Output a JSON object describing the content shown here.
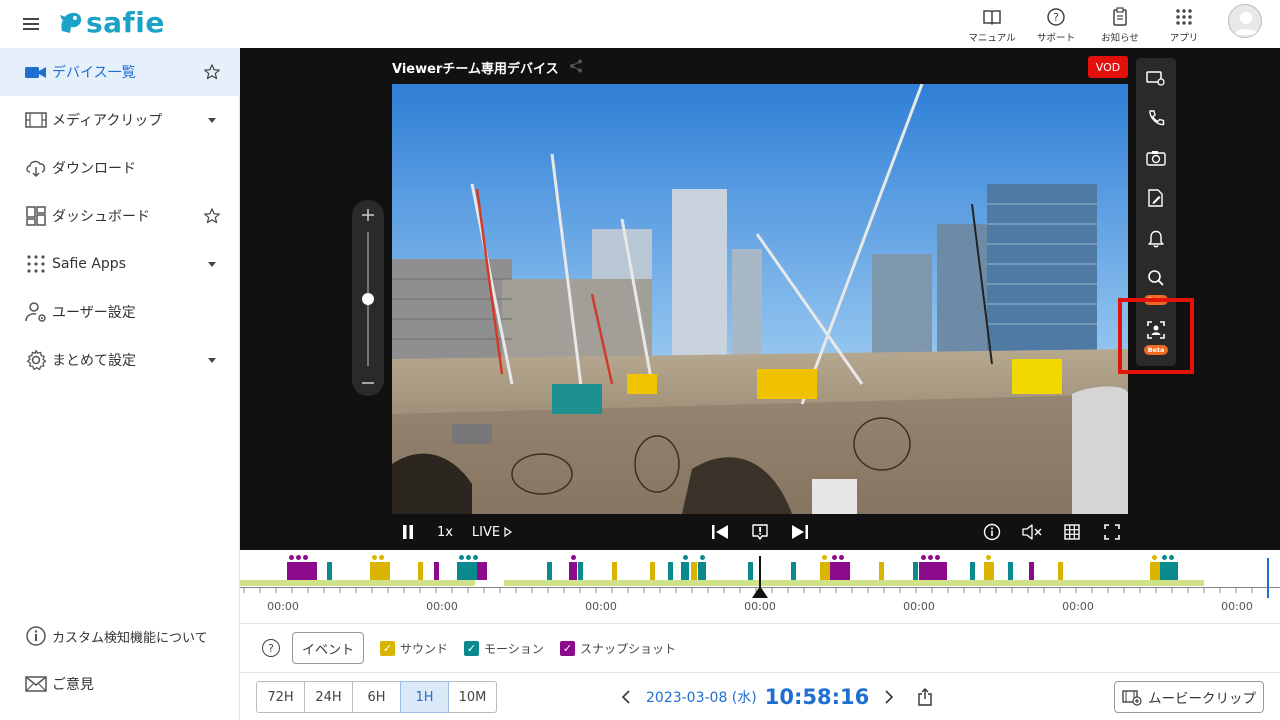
{
  "header": {
    "logo_text": "safie",
    "buttons": [
      {
        "label": "マニュアル",
        "icon": "book-icon"
      },
      {
        "label": "サポート",
        "icon": "help-circle-icon"
      },
      {
        "label": "お知らせ",
        "icon": "clipboard-icon"
      },
      {
        "label": "アプリ",
        "icon": "apps-grid-icon"
      }
    ]
  },
  "sidebar": {
    "items": [
      {
        "label": "デバイス一覧",
        "icon": "video-camera-icon",
        "active": true
      },
      {
        "label": "メディアクリップ",
        "icon": "film-icon"
      },
      {
        "label": "ダウンロード",
        "icon": "cloud-download-icon"
      },
      {
        "label": "ダッシュボード",
        "icon": "dashboard-icon"
      },
      {
        "label": "Safie Apps",
        "icon": "dots-grid-icon"
      },
      {
        "label": "ユーザー設定",
        "icon": "user-gear-icon"
      },
      {
        "label": "まとめて設定",
        "icon": "gear-icon"
      }
    ],
    "footer": [
      {
        "label": "カスタム検知機能について",
        "icon": "info-icon"
      },
      {
        "label": "ご意見",
        "icon": "mail-icon"
      }
    ]
  },
  "viewer": {
    "camera_name": "Viewerチーム専用デバイス",
    "mode_badge": "VOD",
    "speed": "1x",
    "live_label": "LIVE",
    "zoom_level": 0.5,
    "beta_label": "Beta"
  },
  "timeline": {
    "tick_labels": [
      "00:00",
      "00:00",
      "00:00",
      "00:00",
      "00:00",
      "00:00",
      "00:00"
    ],
    "colors": {
      "sound": "#d9b400",
      "motion": "#0a8a8c",
      "snapshot": "#8c0a8c",
      "coverage": "#cfe28a"
    }
  },
  "filters": {
    "help": "?",
    "event_label": "イベント",
    "sound_label": "サウンド",
    "motion_label": "モーション",
    "snapshot_label": "スナップショット"
  },
  "bottom": {
    "ranges": [
      "72H",
      "24H",
      "6H",
      "1H",
      "10M"
    ],
    "selected_range": "1H",
    "date": "2023-03-08 (水)",
    "time": "10:58:16",
    "movie_clip_label": "ムービークリップ"
  },
  "colors": {
    "brand": "#1aa3c6",
    "accent": "#1f6fd1",
    "active_bg": "#e6f0fb",
    "vod_red": "#e4100b",
    "beta_orange": "#ec6b1f"
  }
}
